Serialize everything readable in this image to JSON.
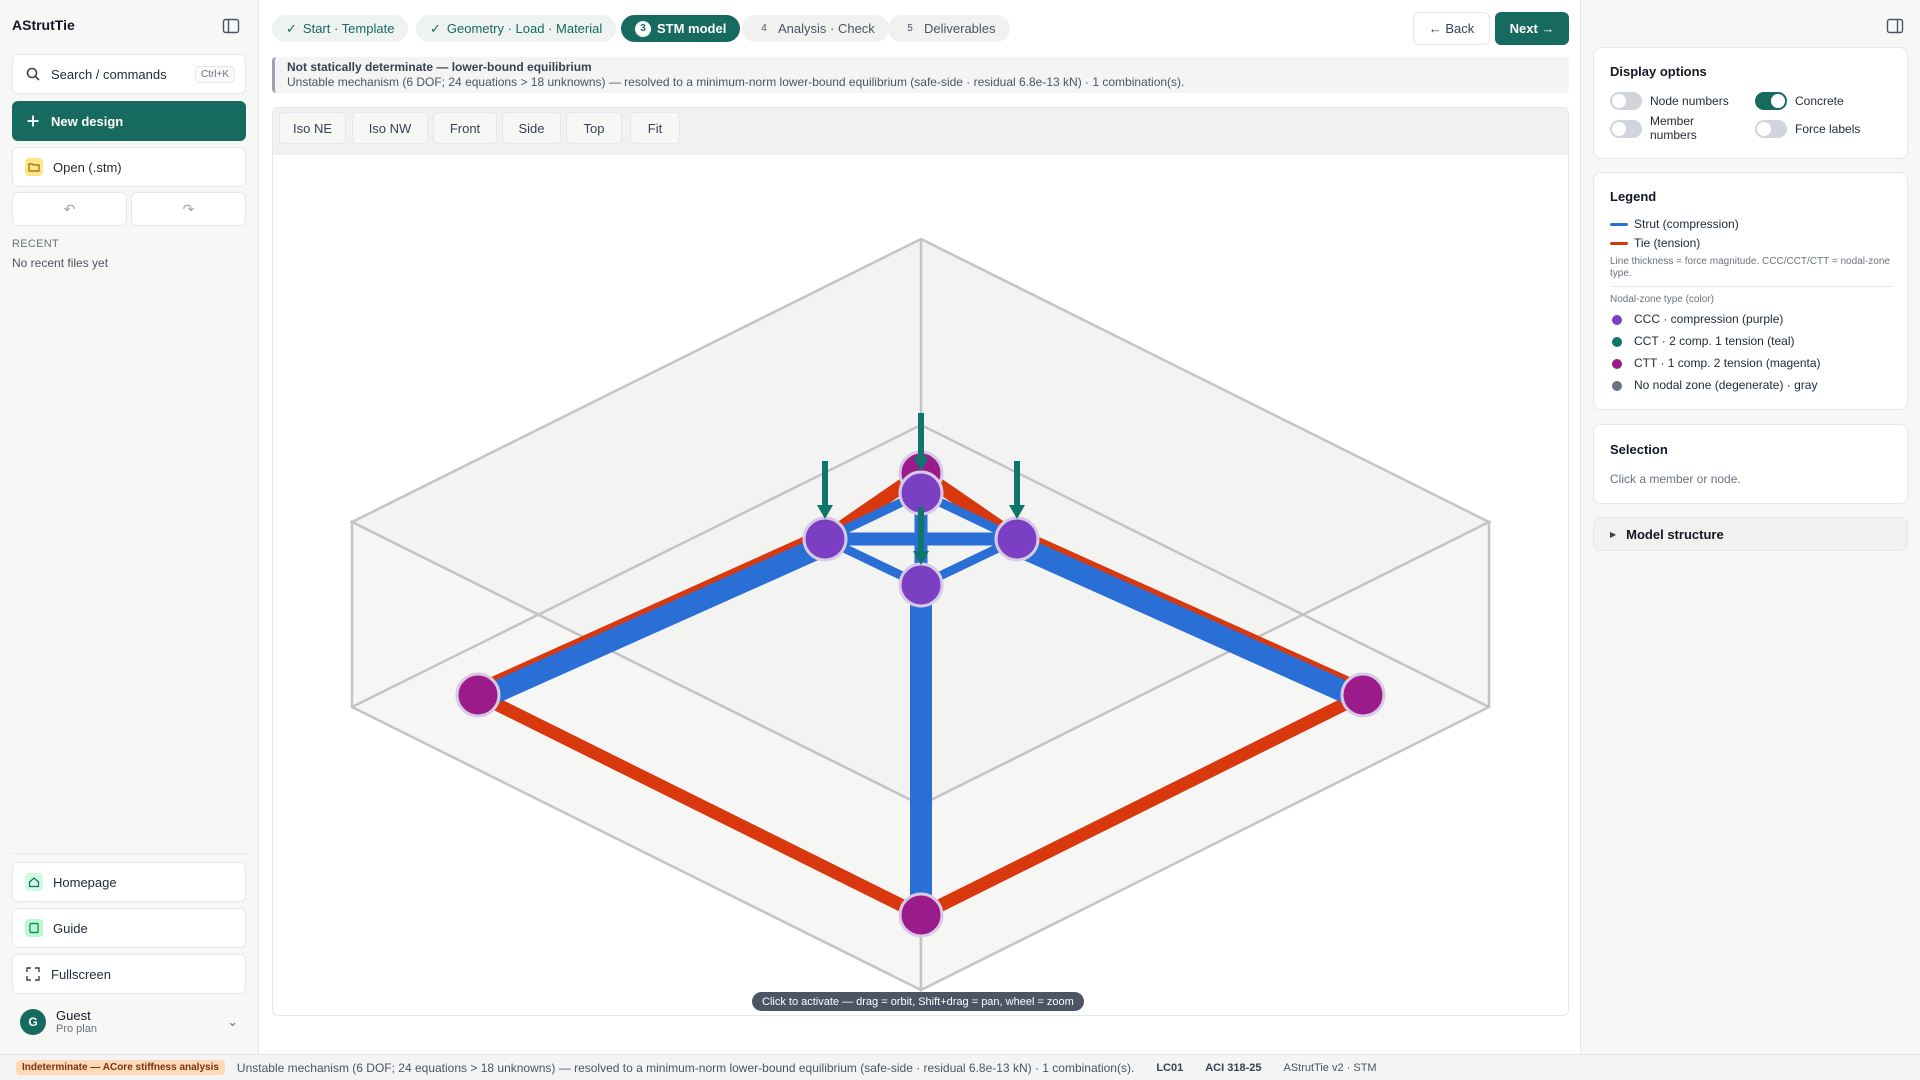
{
  "sidebar": {
    "brand": "AStrutTie",
    "search": {
      "label": "Search / commands",
      "shortcut": "Ctrl+K"
    },
    "new_design": "New design",
    "open_file": "Open (.stm)",
    "recent_heading": "RECENT",
    "recent_empty": "No recent files yet",
    "links": [
      {
        "label": "Homepage",
        "icon": "home-icon"
      },
      {
        "label": "Guide",
        "icon": "book-icon"
      },
      {
        "label": "Fullscreen",
        "icon": "fullscreen-icon"
      }
    ],
    "user": {
      "initial": "G",
      "name": "Guest",
      "plan": "Pro plan"
    }
  },
  "stepper": {
    "steps": [
      {
        "label": "Start · Template",
        "state": "done"
      },
      {
        "label": "Geometry · Load · Material",
        "state": "done"
      },
      {
        "num": "3",
        "label": "STM model",
        "state": "active"
      },
      {
        "num": "4",
        "label": "Analysis · Check",
        "state": "pending"
      },
      {
        "num": "5",
        "label": "Deliverables",
        "state": "pending"
      }
    ],
    "back": "← Back",
    "next": "Next →"
  },
  "banner": {
    "title": "Not statically determinate — lower-bound equilibrium",
    "text": "Unstable mechanism (6 DOF; 24 equations > 18 unknowns) — resolved to a minimum-norm lower-bound equilibrium (safe-side · residual 6.8e-13 kN) · 1 combination(s)."
  },
  "view_buttons": [
    "Iso NE",
    "Iso NW",
    "Front",
    "Side",
    "Top",
    "Fit"
  ],
  "canvas_hint": "Click to activate — drag = orbit, Shift+drag = pan, wheel = zoom",
  "display_options": {
    "title": "Display options",
    "toggles": [
      {
        "label": "Node numbers",
        "on": false
      },
      {
        "label": "Concrete",
        "on": true
      },
      {
        "label": "Member numbers",
        "on": false
      },
      {
        "label": "Force labels",
        "on": false
      }
    ]
  },
  "legend": {
    "title": "Legend",
    "strut": "Strut (compression)",
    "tie": "Tie (tension)",
    "note": "Line thickness = force magnitude. CCC/CCT/CTT = nodal-zone type.",
    "nodal_heading": "Nodal-zone type (color)",
    "nodal": [
      {
        "label": "CCC · compression (purple)",
        "color": "#7b3fc4"
      },
      {
        "label": "CCT · 2 comp. 1 tension (teal)",
        "color": "#0f766e"
      },
      {
        "label": "CTT · 1 comp. 2 tension (magenta)",
        "color": "#9b1b8a"
      },
      {
        "label": "No nodal zone (degenerate) · gray",
        "color": "#6b7280"
      }
    ],
    "strut_color": "#2a6fd6",
    "tie_color": "#d9380f"
  },
  "selection": {
    "title": "Selection",
    "hint": "Click a member or node."
  },
  "model_structure": "Model structure",
  "statusbar": {
    "badge": "Indeterminate — ACore stiffness analysis",
    "message": "Unstable mechanism (6 DOF; 24 equations > 18 unknowns) — resolved to a minimum-norm lower-bound equilibrium (safe-side · residual 6.8e-13 kN) · 1 combination(s).",
    "load_case": "LC01",
    "code": "ACI 318-25",
    "version": "AStrutTie v2 · STM"
  }
}
